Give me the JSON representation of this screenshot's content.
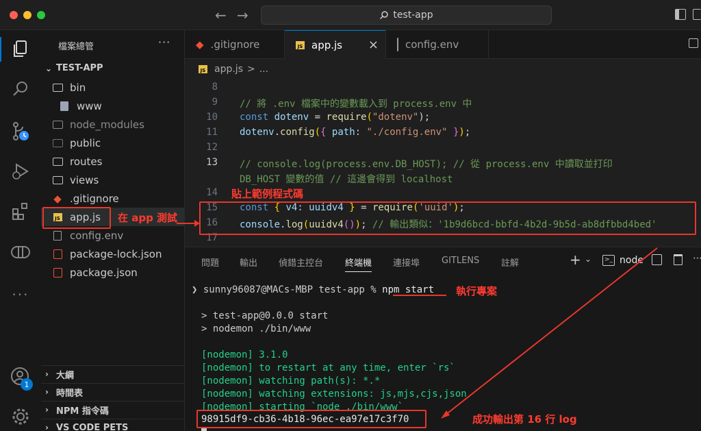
{
  "titlebar": {
    "search_text": "test-app",
    "back_arrow": "←",
    "forward_arrow": "→"
  },
  "sidebar": {
    "title": "檔案總管",
    "more": "···",
    "project": "TEST-APP",
    "items": [
      {
        "label": "bin",
        "type": "folder"
      },
      {
        "label": "www",
        "type": "file"
      },
      {
        "label": "node_modules",
        "type": "folder"
      },
      {
        "label": "public",
        "type": "folder"
      },
      {
        "label": "routes",
        "type": "folder"
      },
      {
        "label": "views",
        "type": "folder"
      },
      {
        "label": ".gitignore",
        "type": "git"
      },
      {
        "label": "app.js",
        "type": "js"
      },
      {
        "label": "config.env",
        "type": "file"
      },
      {
        "label": "package-lock.json",
        "type": "json"
      },
      {
        "label": "package.json",
        "type": "json"
      }
    ],
    "sections": [
      "大綱",
      "時間表",
      "NPM 指令碼",
      "VS CODE PETS"
    ]
  },
  "accounts_badge": "1",
  "tabs": [
    {
      "label": ".gitignore"
    },
    {
      "label": "app.js",
      "close": "×"
    },
    {
      "label": "config.env"
    }
  ],
  "breadcrumb": {
    "file": "app.js",
    "sep": ">",
    "rest": "..."
  },
  "editor": {
    "line_numbers": [
      "8",
      "9",
      "10",
      "11",
      "12",
      "13",
      "",
      "14",
      "15",
      "16",
      "17"
    ],
    "lines": {
      "l9": "// 將 .env 檔案中的變數載入到 process.env 中",
      "l10_kw": "const",
      "l10_var": "dotenv",
      "l10_eq": " = ",
      "l10_fn": "require",
      "l10_str": "\"dotenv\"",
      "l10_end": ");",
      "l11_var": "dotenv",
      "l11_fn": "config",
      "l11_prop": "path",
      "l11_str": "\"./config.env\"",
      "l13a": "// console.log(process.env.DB_HOST); // 從 process.env 中讀取並打印",
      "l13b": "DB_HOST 變數的值 // 這邊會得到 localhost",
      "l15_kw": "const",
      "l15_mid": "v4: uuidv4",
      "l15_fn": "require",
      "l15_str": "'uuid'",
      "l16_obj": "console",
      "l16_fn": "log",
      "l16_arg": "uuidv4",
      "l16_cm": "// 輸出類似：'1b9d6bcd-bbfd-4b2d-9b5d-ab8dfbbd4bed'"
    }
  },
  "panel": {
    "tabs": [
      "問題",
      "輸出",
      "偵錯主控台",
      "終端機",
      "連接埠",
      "GITLENS",
      "註解"
    ],
    "active_tab": "終端機",
    "shell_label": "node",
    "terminal": {
      "prompt": "sunny96087@MACs-MBP test-app % ",
      "command": "npm start",
      "lines": [
        "> test-app@0.0.0 start",
        "> nodemon ./bin/www"
      ],
      "nodemon": [
        {
          "tag": "[nodemon]",
          "text": " 3.1.0"
        },
        {
          "tag": "[nodemon]",
          "text": " to restart at any time, enter `rs`"
        },
        {
          "tag": "[nodemon]",
          "text": " watching path(s): *.*"
        },
        {
          "tag": "[nodemon]",
          "text": " watching extensions: js,mjs,cjs,json"
        },
        {
          "tag": "[nodemon]",
          "text": " starting `node ./bin/www`"
        }
      ],
      "output": "98915df9-cb36-4b18-96ec-ea97e17c3f70"
    }
  },
  "annotations": {
    "test_in_app": "在 app 測試",
    "paste_example": "貼上範例程式碼",
    "run_project": "執行專案",
    "success_output": "成功輸出第 16 行 log"
  },
  "colors": {
    "annotation": "#e8372c",
    "accent": "#0078d4",
    "comment": "#6a9955",
    "keyword": "#569cd6",
    "string": "#ce9178"
  }
}
